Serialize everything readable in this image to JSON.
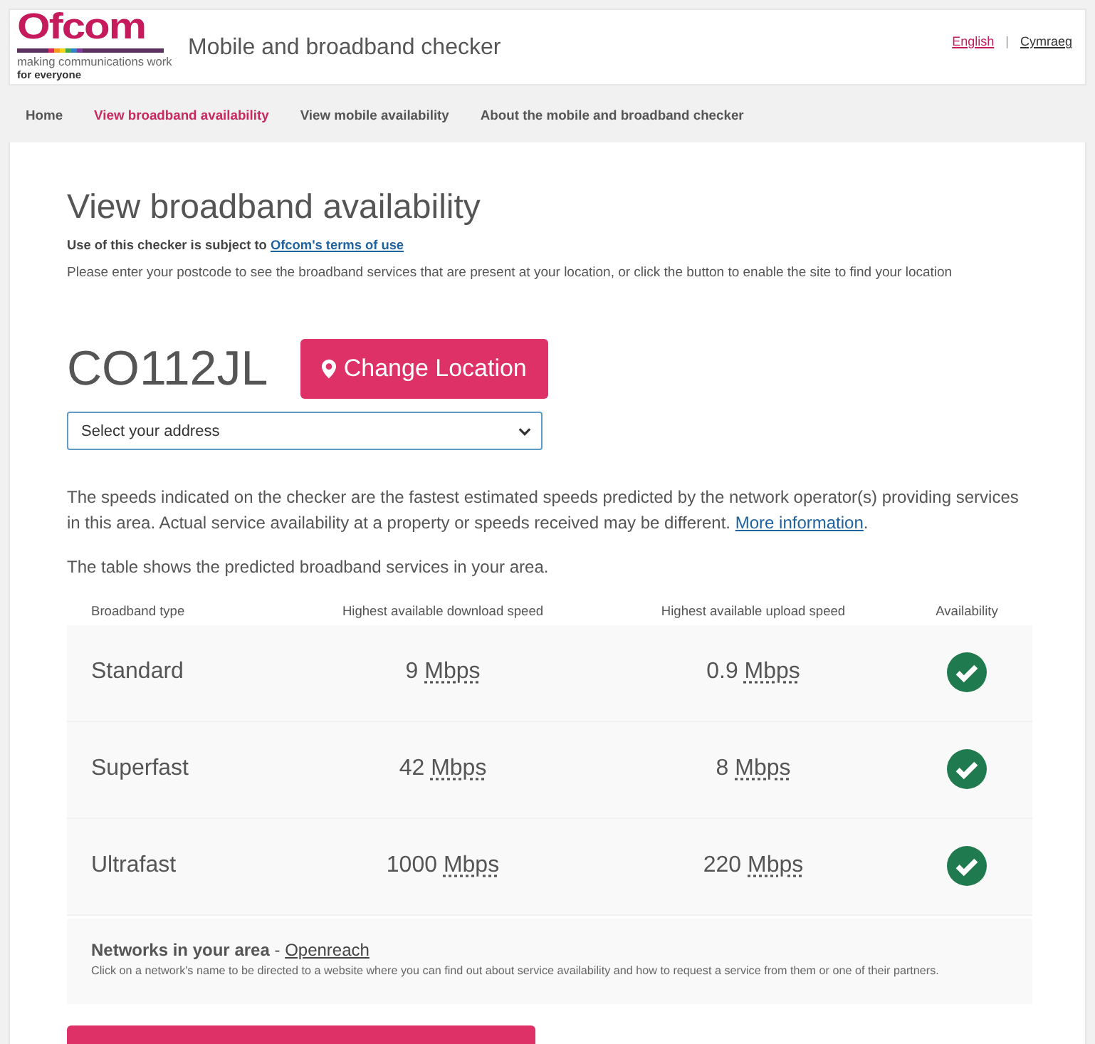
{
  "header": {
    "logo": {
      "wordmark": "Ofcom",
      "tagline": "making communications work",
      "tagline_2": "for everyone"
    },
    "title": "Mobile and broadband checker",
    "languages": [
      {
        "label": "English",
        "selected": true
      },
      {
        "label": "Cymraeg",
        "selected": false
      }
    ],
    "language_separator": "|"
  },
  "nav": [
    {
      "label": "Home",
      "selected": false
    },
    {
      "label": "View broadband availability",
      "selected": true
    },
    {
      "label": "View mobile availability",
      "selected": false
    },
    {
      "label": "About the mobile and broadband checker",
      "selected": false
    }
  ],
  "main": {
    "title": "View broadband availability",
    "terms": {
      "text": "Use of this checker is subject to",
      "link": "Ofcom's terms of use"
    },
    "instructions": "Please enter your postcode to see the broadband services that are present at your location, or click the button to enable the site to find your location",
    "postcode": "CO112JL",
    "change_location_button": "Change Location",
    "address_select": {
      "placeholder": "Select your address"
    },
    "disclaimer": {
      "text": "The speeds indicated on the checker are the fastest estimated speeds predicted by the network operator(s) providing services in this area. Actual service availability at a property or speeds received may be different.",
      "link": "More information",
      "after": "."
    },
    "table_intro": "The table shows the predicted broadband services in your area.",
    "table": {
      "columns": [
        "Broadband type",
        "Highest available download speed",
        "Highest available upload speed",
        "Availability"
      ],
      "rows": [
        {
          "type": "Standard",
          "download": {
            "value": "9",
            "unit": "Mbps"
          },
          "upload": {
            "value": "0.9",
            "unit": "Mbps"
          },
          "available": true
        },
        {
          "type": "Superfast",
          "download": {
            "value": "42",
            "unit": "Mbps"
          },
          "upload": {
            "value": "8",
            "unit": "Mbps"
          },
          "available": true
        },
        {
          "type": "Ultrafast",
          "download": {
            "value": "1000",
            "unit": "Mbps"
          },
          "upload": {
            "value": "220",
            "unit": "Mbps"
          },
          "available": true
        }
      ]
    },
    "networks": {
      "label": "Networks in your area",
      "separator": "-",
      "links": [
        "Openreach"
      ],
      "note": "Click on a network's name to be directed to a website where you can find out about service availability and how to request a service from them or one of their partners."
    }
  }
}
